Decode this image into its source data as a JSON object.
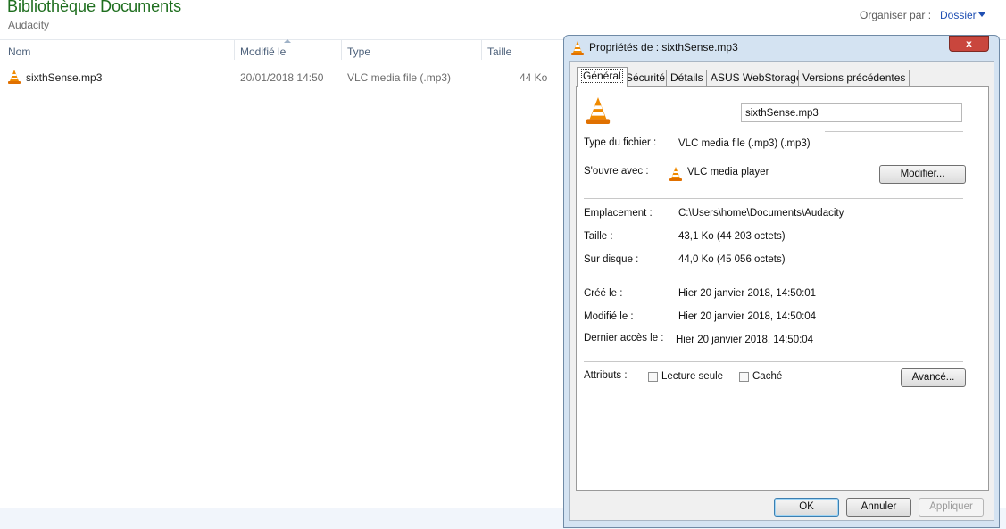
{
  "explorer": {
    "title": "Bibliothèque Documents",
    "subtitle": "Audacity",
    "organize_label": "Organiser par :",
    "organize_value": "Dossier",
    "columns": [
      "Nom",
      "Modifié le",
      "Type",
      "Taille"
    ],
    "files": [
      {
        "name": "sixthSense.mp3",
        "modified": "20/01/2018 14:50",
        "type": "VLC media file (.mp3)",
        "size": "44 Ko",
        "icon": "vlc-cone-icon"
      }
    ]
  },
  "dialog": {
    "title": "Propriétés de : sixthSense.mp3",
    "close": "x",
    "tabs": [
      "Général",
      "Sécurité",
      "Détails",
      "ASUS WebStorage",
      "Versions précédentes"
    ],
    "active_tab": "Général",
    "file_name": "sixthSense.mp3",
    "type_label": "Type du fichier :",
    "type_value": "VLC media file (.mp3) (.mp3)",
    "opens_label": "S'ouvre avec :",
    "opens_value": "VLC media player",
    "modify_button": "Modifier...",
    "location_label": "Emplacement :",
    "location_value": "C:\\Users\\home\\Documents\\Audacity",
    "size_label": "Taille :",
    "size_value": "43,1 Ko (44 203 octets)",
    "disk_label": "Sur disque :",
    "disk_value": "44,0 Ko (45 056 octets)",
    "created_label": "Créé le :",
    "created_value": "Hier 20 janvier 2018, 14:50:01",
    "modified_label": "Modifié le :",
    "modified_value": "Hier 20 janvier 2018, 14:50:04",
    "accessed_label": "Dernier accès le :",
    "accessed_value": "Hier 20 janvier 2018, 14:50:04",
    "attributes_label": "Attributs :",
    "readonly_label": "Lecture seule",
    "hidden_label": "Caché",
    "advanced_button": "Avancé...",
    "ok_button": "OK",
    "cancel_button": "Annuler",
    "apply_button": "Appliquer"
  },
  "colors": {
    "title_green": "#1e6e1e",
    "link_blue": "#1f4fb3",
    "dialog_frame": "#d4e3f2",
    "close_red": "#c9463d",
    "vlc_orange": "#f08a00"
  }
}
